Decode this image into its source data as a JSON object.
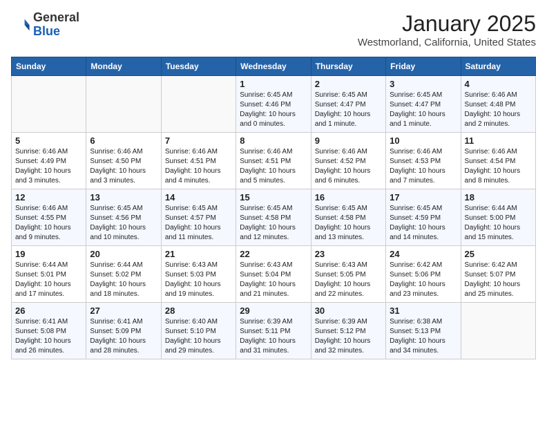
{
  "header": {
    "logo_line1": "General",
    "logo_line2": "Blue",
    "month_title": "January 2025",
    "location": "Westmorland, California, United States"
  },
  "days_of_week": [
    "Sunday",
    "Monday",
    "Tuesday",
    "Wednesday",
    "Thursday",
    "Friday",
    "Saturday"
  ],
  "weeks": [
    [
      {
        "day": "",
        "info": ""
      },
      {
        "day": "",
        "info": ""
      },
      {
        "day": "",
        "info": ""
      },
      {
        "day": "1",
        "info": "Sunrise: 6:45 AM\nSunset: 4:46 PM\nDaylight: 10 hours\nand 0 minutes."
      },
      {
        "day": "2",
        "info": "Sunrise: 6:45 AM\nSunset: 4:47 PM\nDaylight: 10 hours\nand 1 minute."
      },
      {
        "day": "3",
        "info": "Sunrise: 6:45 AM\nSunset: 4:47 PM\nDaylight: 10 hours\nand 1 minute."
      },
      {
        "day": "4",
        "info": "Sunrise: 6:46 AM\nSunset: 4:48 PM\nDaylight: 10 hours\nand 2 minutes."
      }
    ],
    [
      {
        "day": "5",
        "info": "Sunrise: 6:46 AM\nSunset: 4:49 PM\nDaylight: 10 hours\nand 3 minutes."
      },
      {
        "day": "6",
        "info": "Sunrise: 6:46 AM\nSunset: 4:50 PM\nDaylight: 10 hours\nand 3 minutes."
      },
      {
        "day": "7",
        "info": "Sunrise: 6:46 AM\nSunset: 4:51 PM\nDaylight: 10 hours\nand 4 minutes."
      },
      {
        "day": "8",
        "info": "Sunrise: 6:46 AM\nSunset: 4:51 PM\nDaylight: 10 hours\nand 5 minutes."
      },
      {
        "day": "9",
        "info": "Sunrise: 6:46 AM\nSunset: 4:52 PM\nDaylight: 10 hours\nand 6 minutes."
      },
      {
        "day": "10",
        "info": "Sunrise: 6:46 AM\nSunset: 4:53 PM\nDaylight: 10 hours\nand 7 minutes."
      },
      {
        "day": "11",
        "info": "Sunrise: 6:46 AM\nSunset: 4:54 PM\nDaylight: 10 hours\nand 8 minutes."
      }
    ],
    [
      {
        "day": "12",
        "info": "Sunrise: 6:46 AM\nSunset: 4:55 PM\nDaylight: 10 hours\nand 9 minutes."
      },
      {
        "day": "13",
        "info": "Sunrise: 6:45 AM\nSunset: 4:56 PM\nDaylight: 10 hours\nand 10 minutes."
      },
      {
        "day": "14",
        "info": "Sunrise: 6:45 AM\nSunset: 4:57 PM\nDaylight: 10 hours\nand 11 minutes."
      },
      {
        "day": "15",
        "info": "Sunrise: 6:45 AM\nSunset: 4:58 PM\nDaylight: 10 hours\nand 12 minutes."
      },
      {
        "day": "16",
        "info": "Sunrise: 6:45 AM\nSunset: 4:58 PM\nDaylight: 10 hours\nand 13 minutes."
      },
      {
        "day": "17",
        "info": "Sunrise: 6:45 AM\nSunset: 4:59 PM\nDaylight: 10 hours\nand 14 minutes."
      },
      {
        "day": "18",
        "info": "Sunrise: 6:44 AM\nSunset: 5:00 PM\nDaylight: 10 hours\nand 15 minutes."
      }
    ],
    [
      {
        "day": "19",
        "info": "Sunrise: 6:44 AM\nSunset: 5:01 PM\nDaylight: 10 hours\nand 17 minutes."
      },
      {
        "day": "20",
        "info": "Sunrise: 6:44 AM\nSunset: 5:02 PM\nDaylight: 10 hours\nand 18 minutes."
      },
      {
        "day": "21",
        "info": "Sunrise: 6:43 AM\nSunset: 5:03 PM\nDaylight: 10 hours\nand 19 minutes."
      },
      {
        "day": "22",
        "info": "Sunrise: 6:43 AM\nSunset: 5:04 PM\nDaylight: 10 hours\nand 21 minutes."
      },
      {
        "day": "23",
        "info": "Sunrise: 6:43 AM\nSunset: 5:05 PM\nDaylight: 10 hours\nand 22 minutes."
      },
      {
        "day": "24",
        "info": "Sunrise: 6:42 AM\nSunset: 5:06 PM\nDaylight: 10 hours\nand 23 minutes."
      },
      {
        "day": "25",
        "info": "Sunrise: 6:42 AM\nSunset: 5:07 PM\nDaylight: 10 hours\nand 25 minutes."
      }
    ],
    [
      {
        "day": "26",
        "info": "Sunrise: 6:41 AM\nSunset: 5:08 PM\nDaylight: 10 hours\nand 26 minutes."
      },
      {
        "day": "27",
        "info": "Sunrise: 6:41 AM\nSunset: 5:09 PM\nDaylight: 10 hours\nand 28 minutes."
      },
      {
        "day": "28",
        "info": "Sunrise: 6:40 AM\nSunset: 5:10 PM\nDaylight: 10 hours\nand 29 minutes."
      },
      {
        "day": "29",
        "info": "Sunrise: 6:39 AM\nSunset: 5:11 PM\nDaylight: 10 hours\nand 31 minutes."
      },
      {
        "day": "30",
        "info": "Sunrise: 6:39 AM\nSunset: 5:12 PM\nDaylight: 10 hours\nand 32 minutes."
      },
      {
        "day": "31",
        "info": "Sunrise: 6:38 AM\nSunset: 5:13 PM\nDaylight: 10 hours\nand 34 minutes."
      },
      {
        "day": "",
        "info": ""
      }
    ]
  ]
}
